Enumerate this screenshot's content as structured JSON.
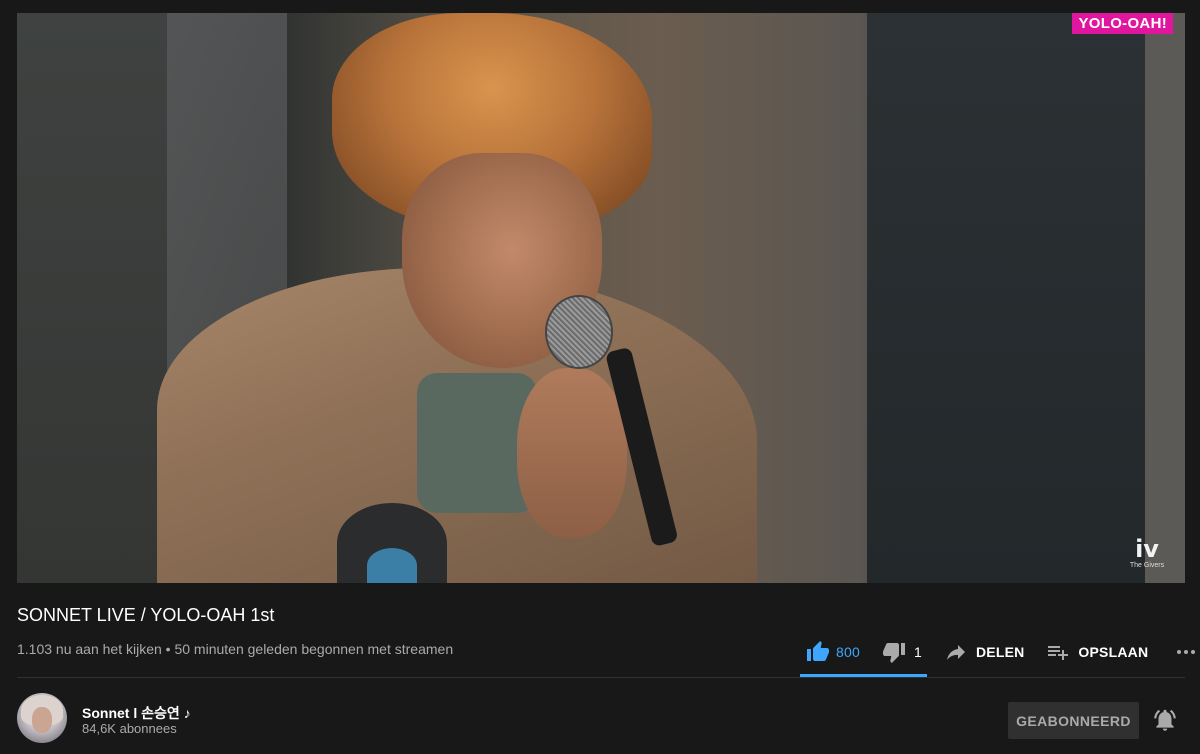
{
  "video": {
    "badge": "YOLO-OAH!",
    "watermark_mark": "iv",
    "watermark_text": "The Givers"
  },
  "title": "SONNET LIVE / YOLO-OAH 1st",
  "meta": "1.103 nu aan het kijken • 50 minuten geleden begonnen met streamen",
  "actions": {
    "likes": "800",
    "dislikes": "1",
    "share_label": "DELEN",
    "save_label": "OPSLAAN",
    "more_glyph": "•••"
  },
  "channel": {
    "name": "Sonnet l 손승연 ♪",
    "subscribers": "84,6K abonnees",
    "subscribe_label": "GEABONNEERD"
  },
  "colors": {
    "background": "#181818",
    "accent": "#3ea6ff",
    "badge": "#e0169f",
    "muted_text": "#aaaaaa"
  },
  "icons": {
    "like": "thumbs-up-icon",
    "dislike": "thumbs-down-icon",
    "share": "share-arrow-icon",
    "save": "playlist-add-icon",
    "more": "more-horizontal-icon",
    "bell": "bell-icon"
  }
}
